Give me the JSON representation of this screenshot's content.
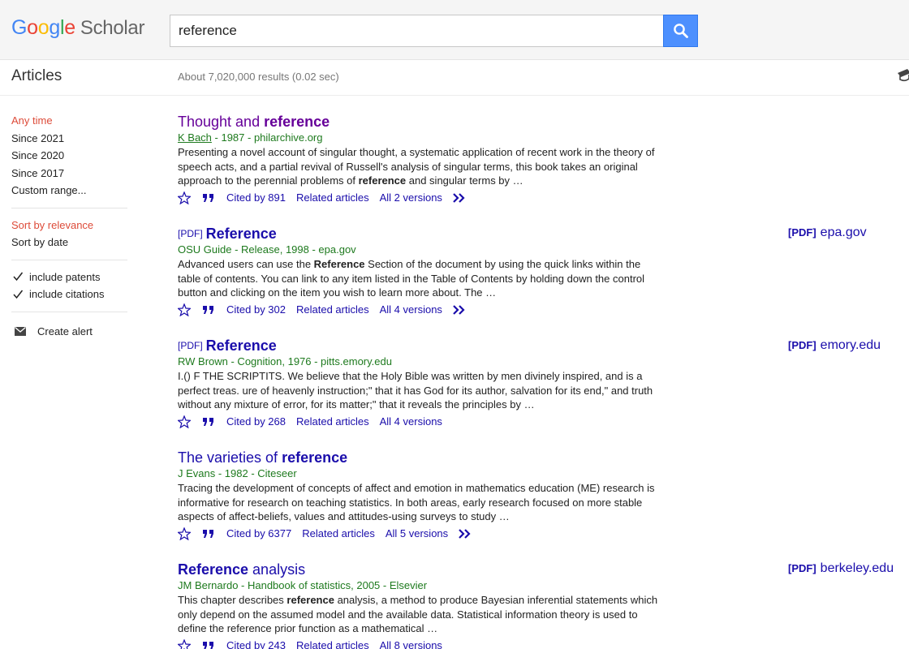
{
  "header": {
    "logo_google": [
      "G",
      "o",
      "o",
      "g",
      "l",
      "e"
    ],
    "logo_scholar": "Scholar",
    "search_value": "reference"
  },
  "subheader": {
    "section": "Articles",
    "results_count": "About 7,020,000 results (0.02 sec)"
  },
  "sidebar": {
    "time_filters": [
      "Any time",
      "Since 2021",
      "Since 2020",
      "Since 2017",
      "Custom range..."
    ],
    "sort_options": [
      "Sort by relevance",
      "Sort by date"
    ],
    "checkboxes": [
      "include patents",
      "include citations"
    ],
    "create_alert": "Create alert"
  },
  "results": [
    {
      "pdf_tag": "",
      "title_pre": "Thought and ",
      "title_bold": "reference",
      "title_post": "",
      "author": "K Bach",
      "meta_rest": " - 1987 - philarchive.org",
      "snippet_pre": "Presenting a novel account of singular thought, a systematic application of recent work in the theory of speech acts, and a partial revival of Russell's analysis of singular terms, this book takes an original approach to the perennial problems of ",
      "snippet_bold": "reference",
      "snippet_post": " and singular terms by …",
      "cited_by": "Cited by 891",
      "related": "Related articles",
      "versions": "All 2 versions",
      "side_tag": "",
      "side_domain": ""
    },
    {
      "pdf_tag": "[PDF]",
      "title_pre": "",
      "title_bold": "Reference",
      "title_post": "",
      "author": "",
      "meta_rest": "OSU Guide - Release, 1998 - epa.gov",
      "snippet_pre": "Advanced users can use the ",
      "snippet_bold": "Reference",
      "snippet_post": " Section of the document by using the quick links within the table of contents. You can link to any item listed in the Table of Contents by holding down the control button and clicking on the item you wish to learn more about. The …",
      "cited_by": "Cited by 302",
      "related": "Related articles",
      "versions": "All 4 versions",
      "side_tag": "[PDF]",
      "side_domain": "epa.gov"
    },
    {
      "pdf_tag": "[PDF]",
      "title_pre": "",
      "title_bold": "Reference",
      "title_post": "",
      "author": "",
      "meta_rest": "RW Brown - Cognition, 1976 - pitts.emory.edu",
      "snippet_pre": "I.() F THE SCRIPTITS. We believe that the Holy Bible was written by men divinely inspired, and is a perfect treas. ure of heavenly instruction;\" that it has God for its author, salvation for its end,\" and truth without any mixture of error, for its matter;\" that it reveals the principles by …",
      "snippet_bold": "",
      "snippet_post": "",
      "cited_by": "Cited by 268",
      "related": "Related articles",
      "versions": "All 4 versions",
      "side_tag": "[PDF]",
      "side_domain": "emory.edu"
    },
    {
      "pdf_tag": "",
      "title_pre": "The varieties of ",
      "title_bold": "reference",
      "title_post": "",
      "author": "",
      "meta_rest": "J Evans - 1982 - Citeseer",
      "snippet_pre": "Tracing the development of concepts of affect and emotion in mathematics education (ME) research is informative for research on teaching statistics. In both areas, early research focused on more stable aspects of affect-beliefs, values and attitudes-using surveys to study …",
      "snippet_bold": "",
      "snippet_post": "",
      "cited_by": "Cited by 6377",
      "related": "Related articles",
      "versions": "All 5 versions",
      "side_tag": "",
      "side_domain": ""
    },
    {
      "pdf_tag": "",
      "title_pre": "",
      "title_bold": "Reference",
      "title_post": " analysis",
      "author": "",
      "meta_rest": "JM Bernardo - Handbook of statistics, 2005 - Elsevier",
      "snippet_pre": "This chapter describes ",
      "snippet_bold": "reference",
      "snippet_post": " analysis, a method to produce Bayesian inferential statements which only depend on the assumed model and the available data. Statistical information theory is used to define the reference prior function as a mathematical …",
      "cited_by": "Cited by 243",
      "related": "Related articles",
      "versions": "All 8 versions",
      "side_tag": "[PDF]",
      "side_domain": "berkeley.edu"
    }
  ],
  "colors": {
    "link": "#1a0dab",
    "visited": "#660099",
    "meta_green": "#1e7a1e",
    "active_red": "#dd4b39",
    "search_button": "#4d90fe"
  }
}
